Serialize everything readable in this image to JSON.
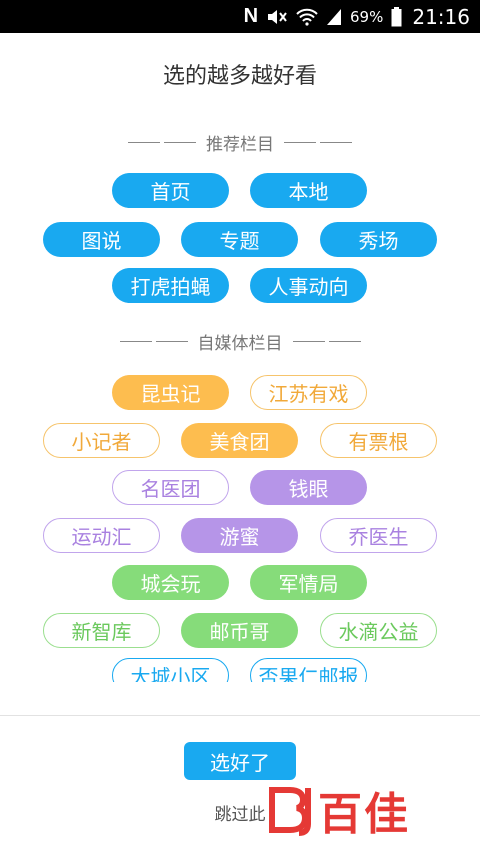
{
  "status_bar": {
    "battery": "69%",
    "time": "21:16",
    "network_letter": "N"
  },
  "header": {
    "title": "选的越多越好看"
  },
  "recommended": {
    "heading": "推荐栏目",
    "items": [
      "首页",
      "本地",
      "图说",
      "专题",
      "秀场",
      "打虎拍蝇",
      "人事动向"
    ]
  },
  "self_media": {
    "heading": "自媒体栏目",
    "items": [
      "昆虫记",
      "江苏有戏",
      "小记者",
      "美食团",
      "有票根",
      "名医团",
      "钱眼",
      "运动汇",
      "游蜜",
      "乔医生",
      "城会玩",
      "军情局",
      "新智库",
      "邮币哥",
      "水滴公益",
      "大城小区",
      "否果仁邮报"
    ]
  },
  "footer": {
    "done_label": "选好了",
    "skip_label": "跳过此"
  },
  "watermark": {
    "text": "百佳",
    "prefix": "Bj"
  },
  "colors": {
    "blue": "#19a9f0",
    "orange": "#fdbd4f",
    "purple": "#b695e8",
    "green": "#86dc7a"
  }
}
